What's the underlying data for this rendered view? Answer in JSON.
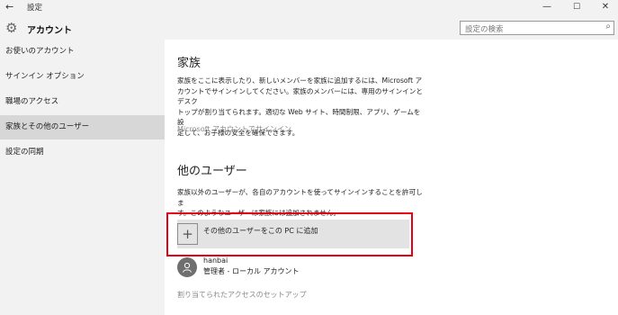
{
  "titlebar": {
    "back_glyph": "←",
    "title": "設定",
    "min_glyph": "—",
    "max_glyph": "☐",
    "close_glyph": "✕"
  },
  "header": {
    "section_title": "アカウント",
    "search_placeholder": "設定の検索",
    "gear_icon": "gear-icon",
    "search_icon": "search-icon"
  },
  "sidebar": {
    "items": [
      {
        "label": "お使いのアカウント"
      },
      {
        "label": "サインイン オプション"
      },
      {
        "label": "職場のアクセス"
      },
      {
        "label": "家族とその他のユーザー",
        "selected": true
      },
      {
        "label": "設定の同期"
      }
    ]
  },
  "family": {
    "heading": "家族",
    "description_lines": [
      "家族をここに表示したり、新しいメンバーを家族に追加するには、Microsoft ア",
      "カウントでサインインしてください。家族のメンバーには、専用のサインインとデスク",
      "トップが割り当てられます。適切な Web サイト、時間制限、アプリ、ゲームを設",
      "定して、お子様の安全を確保できます。"
    ],
    "signin_link": "Microsoft アカウントでサインイン"
  },
  "other_users": {
    "heading": "他のユーザー",
    "description_lines": [
      "家族以外のユーザーが、各自のアカウントを使ってサインインすることを許可しま",
      "す。このようなユーザーは家族には追加されません。"
    ],
    "add_button_glyph": "+",
    "add_button_label": "その他のユーザーをこの PC に追加",
    "user": {
      "name": "hanbai",
      "type": "管理者 - ローカル アカウント"
    },
    "assigned_access_link": "割り当てられたアクセスのセットアップ"
  },
  "colors": {
    "highlight_box": "#e60012",
    "selected_nav": "#d7d7d7",
    "chrome": "#f2f2f2"
  }
}
